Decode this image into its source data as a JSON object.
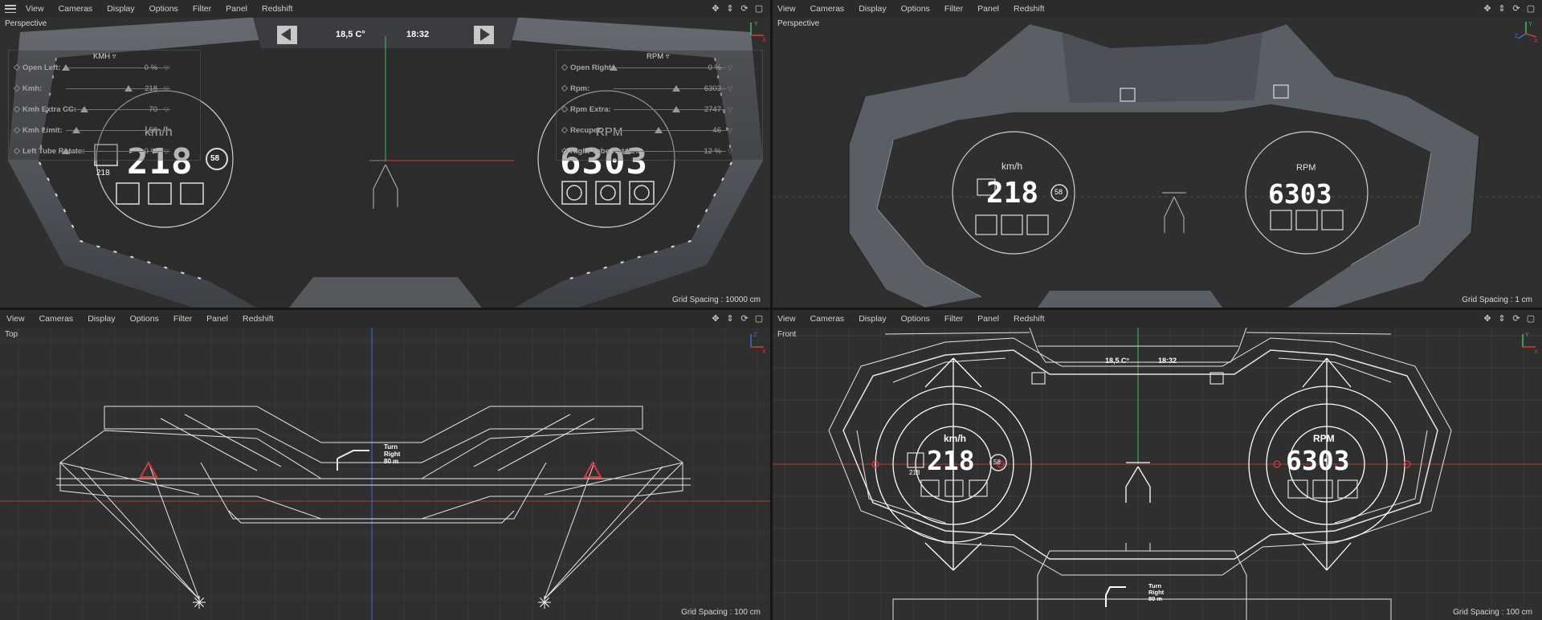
{
  "menu": {
    "items": [
      "View",
      "Cameras",
      "Display",
      "Options",
      "Filter",
      "Panel",
      "Redshift"
    ]
  },
  "viewports": {
    "top_left": {
      "label": "Perspective",
      "grid_spacing": "Grid Spacing : 10000 cm",
      "dashboard": {
        "temperature": "18,5 C°",
        "clock": "18:32",
        "kmh_title": "km/h",
        "kmh_value": "218",
        "kmh_small": "218",
        "kmh_limit_badge": "58",
        "rpm_title": "RPM",
        "rpm_value": "6303"
      },
      "left_panel": {
        "unit": "KMH",
        "rows": [
          {
            "label": "Open Left:",
            "value": "0 %",
            "level": 0.0
          },
          {
            "label": "Kmh:",
            "value": "218",
            "level": 0.6
          },
          {
            "label": "Kmh Extra CC:",
            "value": "70",
            "level": 0.18
          },
          {
            "label": "Kmh Limit:",
            "value": "58",
            "level": 0.1
          },
          {
            "label": "Left Tube Rotate:",
            "value": "0 %",
            "level": 0.0
          }
        ]
      },
      "right_panel": {
        "unit": "RPM",
        "rows": [
          {
            "label": "Open Right:",
            "value": "0 %",
            "level": 0.0
          },
          {
            "label": "Rpm:",
            "value": "6303",
            "level": 0.56
          },
          {
            "label": "Rpm Extra:",
            "value": "2747",
            "level": 0.56
          },
          {
            "label": "Recuper",
            "value": "46",
            "level": 0.4
          },
          {
            "label": "Right Tube Rotate:",
            "value": "12 %",
            "level": 0.12
          }
        ]
      }
    },
    "top_right": {
      "label": "Perspective",
      "grid_spacing": "Grid Spacing : 1 cm",
      "dashboard": {
        "kmh_title": "km/h",
        "kmh_value": "218",
        "kmh_limit_badge": "58",
        "rpm_title": "RPM",
        "rpm_value": "6303"
      }
    },
    "bottom_left": {
      "label": "Top",
      "grid_spacing": "Grid Spacing : 100 cm",
      "nav_text_line1": "Turn",
      "nav_text_line2": "Right",
      "nav_text_line3": "80 m"
    },
    "bottom_right": {
      "label": "Front",
      "grid_spacing": "Grid Spacing : 100 cm",
      "dashboard": {
        "temperature": "18,5 C°",
        "clock": "18:32",
        "kmh_title": "km/h",
        "kmh_value": "218",
        "kmh_small": "218",
        "kmh_limit_badge": "58",
        "rpm_title": "RPM",
        "rpm_value": "6303",
        "nav_text_line1": "Turn",
        "nav_text_line2": "Right",
        "nav_text_line3": "80 m"
      }
    }
  },
  "icons": {
    "menu": "hamburger-icon",
    "tools": [
      "move-view-icon",
      "zoom-view-icon",
      "rotate-view-icon",
      "maximize-viewport-icon"
    ]
  },
  "colors": {
    "viewport_bg": "#2f2f2f",
    "wire": "#ffffff",
    "axis_x": "#d9383a",
    "axis_y": "#3fbf5a",
    "axis_z": "#3b6fd8"
  }
}
